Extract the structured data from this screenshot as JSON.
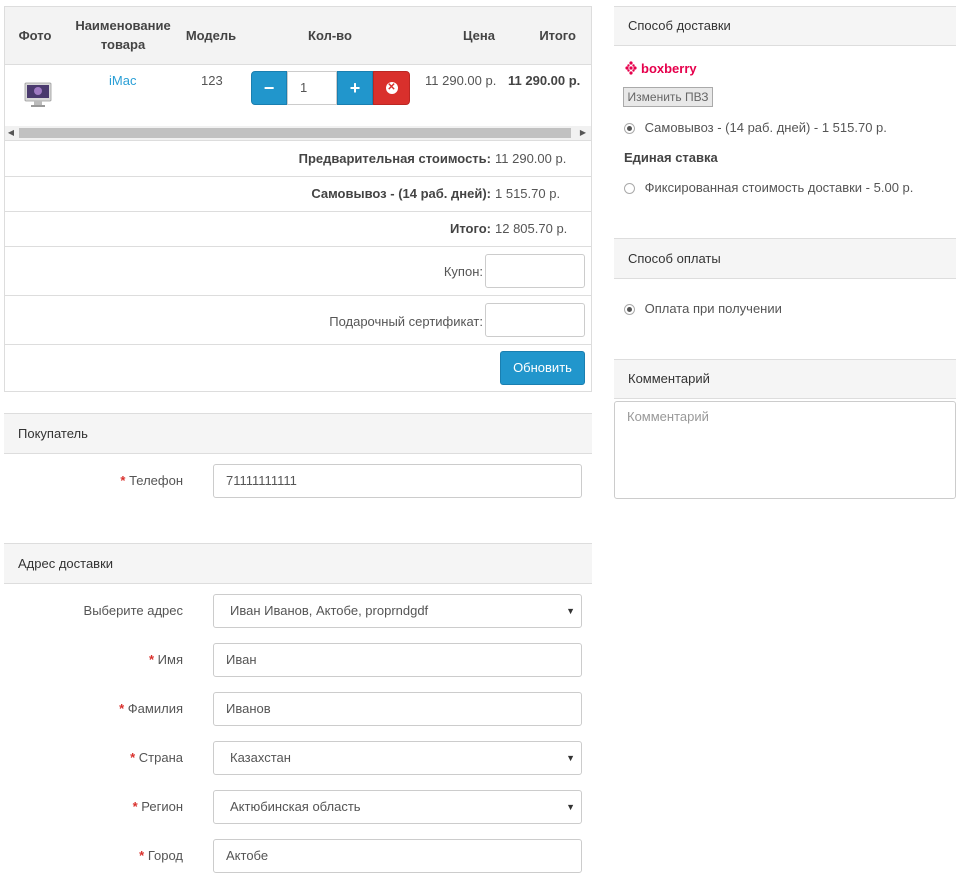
{
  "cart": {
    "headers": {
      "photo": "Фото",
      "name": "Наименование товара",
      "model": "Модель",
      "qty": "Кол-во",
      "price": "Цена",
      "total": "Итого"
    },
    "item": {
      "name": "iMac",
      "model": "123",
      "qty": "1",
      "price": "11 290.00 р.",
      "total": "11 290.00 р."
    },
    "totals": [
      {
        "label": "Предварительная стоимость:",
        "value": "11 290.00 р."
      },
      {
        "label": "Самовывоз - (14 раб. дней):",
        "value": "1 515.70 р."
      },
      {
        "label": "Итого:",
        "value": "12 805.70 р."
      }
    ],
    "coupon_label": "Купон:",
    "gift_label": "Подарочный сертификат:",
    "update_button": "Обновить"
  },
  "buyer": {
    "title": "Покупатель",
    "phone_label": "Телефон",
    "phone_value": "71111111111"
  },
  "address": {
    "title": "Адрес доставки",
    "select_label": "Выберите адрес",
    "select_value": "Иван Иванов, Актобе, proprndgdf",
    "first_name_label": "Имя",
    "first_name": "Иван",
    "last_name_label": "Фамилия",
    "last_name": "Иванов",
    "country_label": "Страна",
    "country": "Казахстан",
    "region_label": "Регион",
    "region": "Актюбинская область",
    "city_label": "Город",
    "city": "Актобе"
  },
  "shipping": {
    "title": "Способ доставки",
    "brand": "boxberry",
    "brand_color": "#e6004c",
    "change_button": "Изменить ПВЗ",
    "option1": "Самовывоз - (14 раб. дней) - 1 515.70 р.",
    "group2_title": "Единая ставка",
    "option2": "Фиксированная стоимость доставки - 5.00 р."
  },
  "payment": {
    "title": "Способ оплаты",
    "option1": "Оплата при получении"
  },
  "comment": {
    "title": "Комментарий",
    "placeholder": "Комментарий"
  }
}
